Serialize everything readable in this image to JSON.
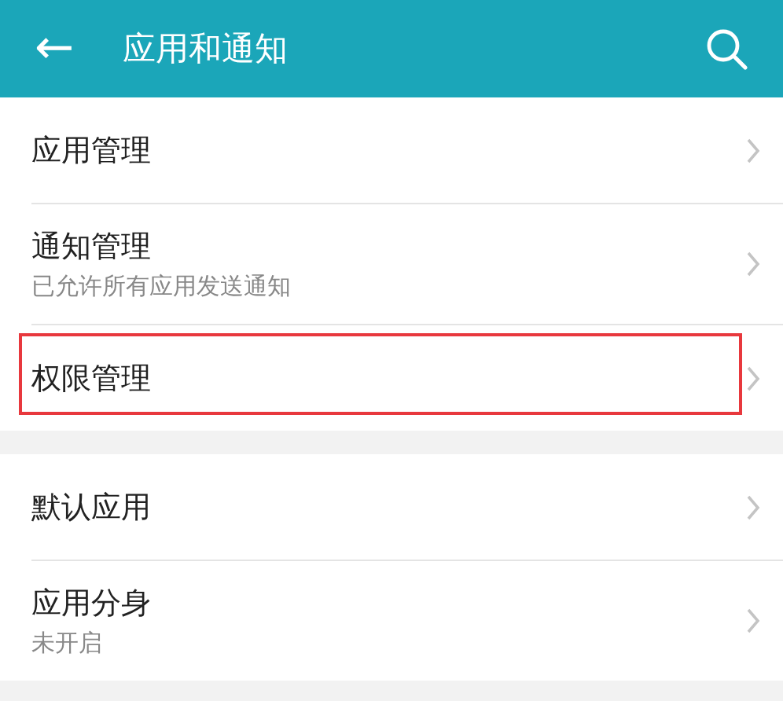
{
  "header": {
    "back": "←",
    "title": "应用和通知"
  },
  "groups": [
    {
      "items": [
        {
          "title": "应用管理",
          "highlighted": false
        },
        {
          "title": "通知管理",
          "subtitle": "已允许所有应用发送通知",
          "highlighted": false
        },
        {
          "title": "权限管理",
          "highlighted": true
        }
      ]
    },
    {
      "items": [
        {
          "title": "默认应用",
          "highlighted": false
        },
        {
          "title": "应用分身",
          "subtitle": "未开启",
          "highlighted": false
        }
      ]
    }
  ]
}
